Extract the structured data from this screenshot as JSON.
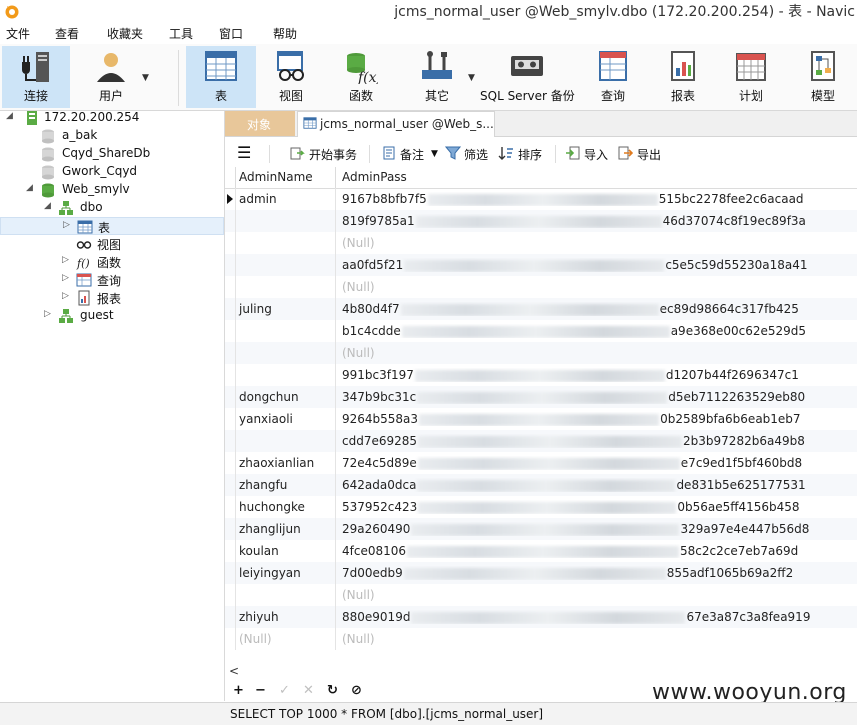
{
  "window": {
    "title": "jcms_normal_user @Web_smylv.dbo (172.20.200.254) - 表 - Navic"
  },
  "menu": [
    "文件",
    "查看",
    "收藏夹",
    "工具",
    "窗口",
    "帮助"
  ],
  "toolbar": {
    "connect": "连接",
    "user": "用户",
    "table": "表",
    "view": "视图",
    "function": "函数",
    "other": "其它",
    "backup": "SQL Server 备份",
    "query": "查询",
    "report": "报表",
    "schedule": "计划",
    "model": "模型"
  },
  "tree": {
    "server": "172.20.200.254",
    "databases": [
      "a_bak",
      "Cqyd_ShareDb",
      "Gwork_Cqyd",
      "Web_smylv"
    ],
    "schema": "dbo",
    "schema_items": [
      "表",
      "视图",
      "函数",
      "查询",
      "报表"
    ],
    "guest": "guest"
  },
  "tabs": {
    "objects": "对象",
    "table_tab": "jcms_normal_user @Web_s..."
  },
  "grid_toolbar": {
    "begin_tx": "开始事务",
    "memo": "备注",
    "filter": "筛选",
    "sort": "排序",
    "import": "导入",
    "export": "导出"
  },
  "grid": {
    "columns": [
      "AdminName",
      "AdminPass"
    ],
    "rows": [
      {
        "name": "admin",
        "prefix": "9167b8bfb7f5",
        "suffix": "515bc2278fee2c6acaad",
        "blur": 230
      },
      {
        "name": "",
        "prefix": "819f9785a1",
        "suffix": "46d37074c8f19ec89f3a",
        "blur": 246
      },
      {
        "name": "",
        "null": "(Null)"
      },
      {
        "name": "",
        "prefix": "aa0fd5f21",
        "suffix": "c5e5c59d55230a18a41",
        "blur": 260
      },
      {
        "name": "",
        "null": "(Null)"
      },
      {
        "name": "juling",
        "prefix": "4b80d4f7",
        "suffix": "ec89d98664c317fb425",
        "blur": 258
      },
      {
        "name": "",
        "prefix": "b1c4cdde",
        "suffix": "a9e368e00c62e529d5",
        "blur": 268
      },
      {
        "name": "",
        "null": "(Null)"
      },
      {
        "name": "",
        "prefix": "991bc3f197",
        "suffix": "d1207b44f2696347c1",
        "blur": 250
      },
      {
        "name": "dongchun",
        "prefix": "347b9bc31c",
        "suffix": "d5eb7112263529eb80",
        "blur": 250
      },
      {
        "name": "yanxiaoli",
        "prefix": "9264b558a3",
        "suffix": "0b2589bfa6b6eab1eb7",
        "blur": 240
      },
      {
        "name": "",
        "prefix": "cdd7e69285",
        "suffix": "2b3b97282b6a49b8",
        "blur": 264
      },
      {
        "name": "zhaoxianlian",
        "prefix": "72e4c5d89e",
        "suffix": "e7c9ed1f5bf460bd8",
        "blur": 262
      },
      {
        "name": "zhangfu",
        "prefix": "642ada0dca",
        "suffix": "de831b5e625177531",
        "blur": 258
      },
      {
        "name": "huchongke",
        "prefix": "537952c423",
        "suffix": "0b56ae5ff4156b458",
        "blur": 258
      },
      {
        "name": "zhanglijun",
        "prefix": "29a260490",
        "suffix": "329a97e4e447b56d8",
        "blur": 268
      },
      {
        "name": "koulan",
        "prefix": "4fce08106",
        "suffix": "58c2c2ce7eb7a69d",
        "blur": 272
      },
      {
        "name": "leiyingyan",
        "prefix": "7d00edb9",
        "suffix": "855adf1065b69a2ff2",
        "blur": 262
      },
      {
        "name": "",
        "null": "(Null)"
      },
      {
        "name": "zhiyuh",
        "prefix": "880e9019d",
        "suffix": "67e3a87c3a8fea919",
        "blur": 274
      },
      {
        "name": "(Null)",
        "nameNull": true,
        "null": "(Null)"
      }
    ]
  },
  "watermark": "www.wooyun.org",
  "status": "SELECT TOP 1000  * FROM [dbo].[jcms_normal_user]",
  "hscroll": "<"
}
